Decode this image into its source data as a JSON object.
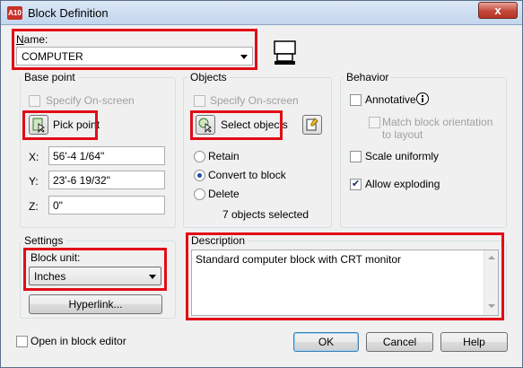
{
  "window": {
    "title": "Block Definition",
    "app_icon_text": "A10",
    "close_glyph": "x"
  },
  "name": {
    "label": "Name:",
    "value": "COMPUTER"
  },
  "base_point": {
    "legend": "Base point",
    "specify_onscreen": "Specify On-screen",
    "pick_point": "Pick point",
    "x_label": "X:",
    "x_value": "56'-4 1/64\"",
    "y_label": "Y:",
    "y_value": "23'-6 19/32\"",
    "z_label": "Z:",
    "z_value": "0\""
  },
  "objects": {
    "legend": "Objects",
    "specify_onscreen": "Specify On-screen",
    "select_objects": "Select objects",
    "retain": "Retain",
    "convert": "Convert to block",
    "delete": "Delete",
    "selected_count": "7 objects selected"
  },
  "behavior": {
    "legend": "Behavior",
    "annotative": "Annotative",
    "match_orientation": "Match block orientation to layout",
    "scale_uniformly": "Scale uniformly",
    "allow_exploding": "Allow exploding"
  },
  "settings": {
    "legend": "Settings",
    "block_unit_label": "Block unit:",
    "block_unit_value": "Inches",
    "hyperlink": "Hyperlink..."
  },
  "description": {
    "legend": "Description",
    "value": "Standard computer block with CRT monitor"
  },
  "footer": {
    "open_in_editor": "Open in block editor",
    "ok": "OK",
    "cancel": "Cancel",
    "help": "Help"
  },
  "colors": {
    "highlight": "#e20c16",
    "title_gradient_top": "#dbe7f5",
    "close_button": "#c4483a"
  },
  "icons": [
    "app-icon",
    "close-icon",
    "computer-preview-icon",
    "pick-point-icon",
    "select-objects-icon",
    "quick-select-icon",
    "info-icon",
    "dropdown-arrow-icon"
  ]
}
